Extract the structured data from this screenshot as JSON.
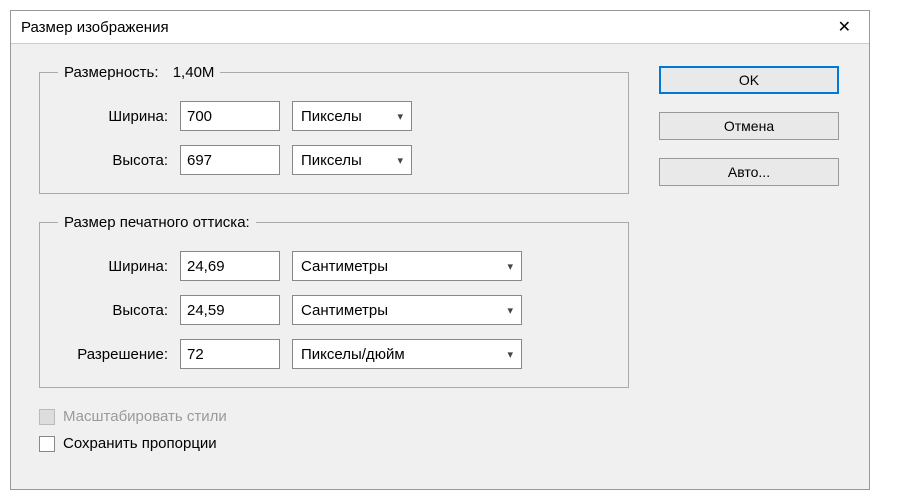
{
  "title": "Размер изображения",
  "buttons": {
    "ok": "OK",
    "cancel": "Отмена",
    "auto": "Авто..."
  },
  "pixel_group": {
    "legend": "Размерность:",
    "size_summary": "1,40M",
    "width_label": "Ширина:",
    "width_value": "700",
    "width_unit": "Пикселы",
    "height_label": "Высота:",
    "height_value": "697",
    "height_unit": "Пикселы"
  },
  "print_group": {
    "legend": "Размер печатного оттиска:",
    "width_label": "Ширина:",
    "width_value": "24,69",
    "width_unit": "Сантиметры",
    "height_label": "Высота:",
    "height_value": "24,59",
    "height_unit": "Сантиметры",
    "resolution_label": "Разрешение:",
    "resolution_value": "72",
    "resolution_unit": "Пикселы/дюйм"
  },
  "checks": {
    "scale_styles": "Масштабировать стили",
    "constrain": "Сохранить пропорции"
  }
}
